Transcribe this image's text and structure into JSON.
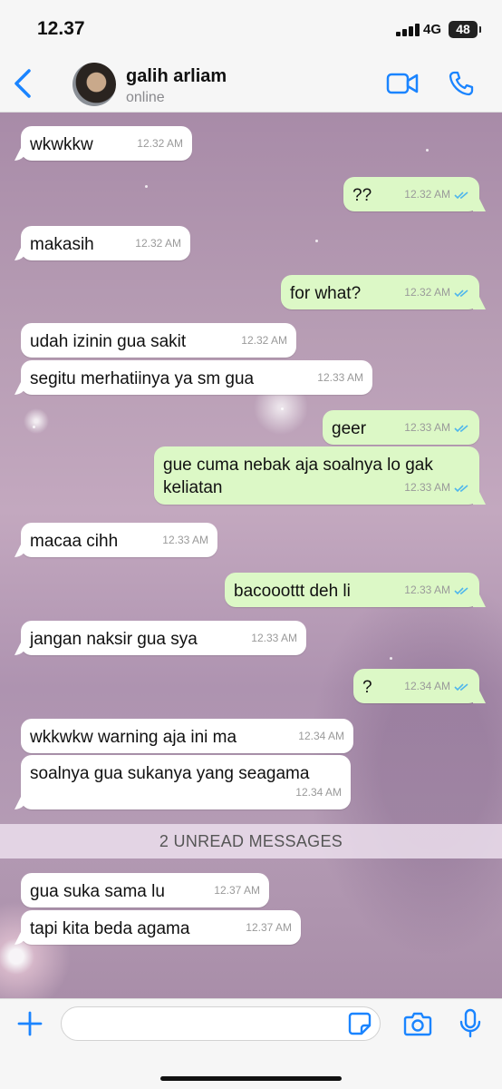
{
  "status_bar": {
    "time": "12.37",
    "network": "4G",
    "battery": "48"
  },
  "header": {
    "contact_name": "galih arliam",
    "presence": "online"
  },
  "colors": {
    "accent": "#1a84ff",
    "outgoing_bubble": "#dcf8c6",
    "incoming_bubble": "#ffffff",
    "read_ticks": "#4fb6ec"
  },
  "messages": [
    {
      "dir": "in",
      "text": "wkwkkw",
      "time": "12.32 AM"
    },
    {
      "dir": "out",
      "text": "??",
      "time": "12.32 AM",
      "status": "read"
    },
    {
      "dir": "in",
      "text": "makasih",
      "time": "12.32 AM"
    },
    {
      "dir": "out",
      "text": "for what?",
      "time": "12.32 AM",
      "status": "read"
    },
    {
      "dir": "in",
      "text": "udah izinin gua sakit",
      "time": "12.32 AM"
    },
    {
      "dir": "in",
      "text": "segitu merhatiinya ya sm gua",
      "time": "12.33 AM"
    },
    {
      "dir": "out",
      "text": "geer",
      "time": "12.33 AM",
      "status": "read"
    },
    {
      "dir": "out",
      "text": "gue cuma nebak aja soalnya lo gak\nkeliatan",
      "time": "12.33 AM",
      "status": "read"
    },
    {
      "dir": "in",
      "text": "macaa cihh",
      "time": "12.33 AM"
    },
    {
      "dir": "out",
      "text": "bacooottt deh li",
      "time": "12.33 AM",
      "status": "read"
    },
    {
      "dir": "in",
      "text": "jangan naksir gua sya",
      "time": "12.33 AM"
    },
    {
      "dir": "out",
      "text": "?",
      "time": "12.34 AM",
      "status": "read"
    },
    {
      "dir": "in",
      "text": "wkkwkw warning aja ini ma",
      "time": "12.34 AM"
    },
    {
      "dir": "in",
      "text": "soalnya gua sukanya yang seagama",
      "time": "12.34 AM"
    },
    {
      "dir": "in",
      "text": "gua suka sama lu",
      "time": "12.37 AM"
    },
    {
      "dir": "in",
      "text": "tapi kita beda agama",
      "time": "12.37 AM"
    }
  ],
  "unread_divider": "2 UNREAD MESSAGES",
  "composer": {
    "value": "",
    "placeholder": ""
  },
  "icons": {
    "back": "chevron-left-icon",
    "video": "video-camera-icon",
    "call": "phone-icon",
    "attach": "plus-icon",
    "sticker": "sticker-icon",
    "camera": "camera-icon",
    "mic": "microphone-icon"
  }
}
